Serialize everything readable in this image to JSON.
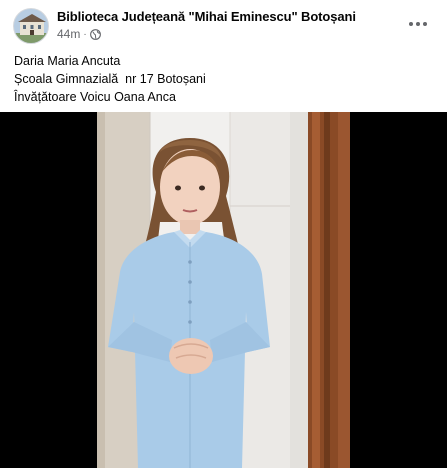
{
  "post": {
    "page_name": "Biblioteca Județeană \"Mihai Eminescu\" Botoșani",
    "timestamp": "44m",
    "separator": "·",
    "audience_icon": "globe-icon",
    "more_icon": "more-options-icon",
    "text_lines": [
      "Daria Maria Ancuta",
      "Școala Gimnazială  nr 17 Botoșani",
      "Învățătoare Voicu Oana Anca"
    ]
  },
  "video": {
    "description": "girl in light blue dress reciting"
  },
  "colors": {
    "text_primary": "#050505",
    "text_secondary": "#65676b",
    "video_background": "#000000",
    "dress": "#a9cbe8"
  }
}
